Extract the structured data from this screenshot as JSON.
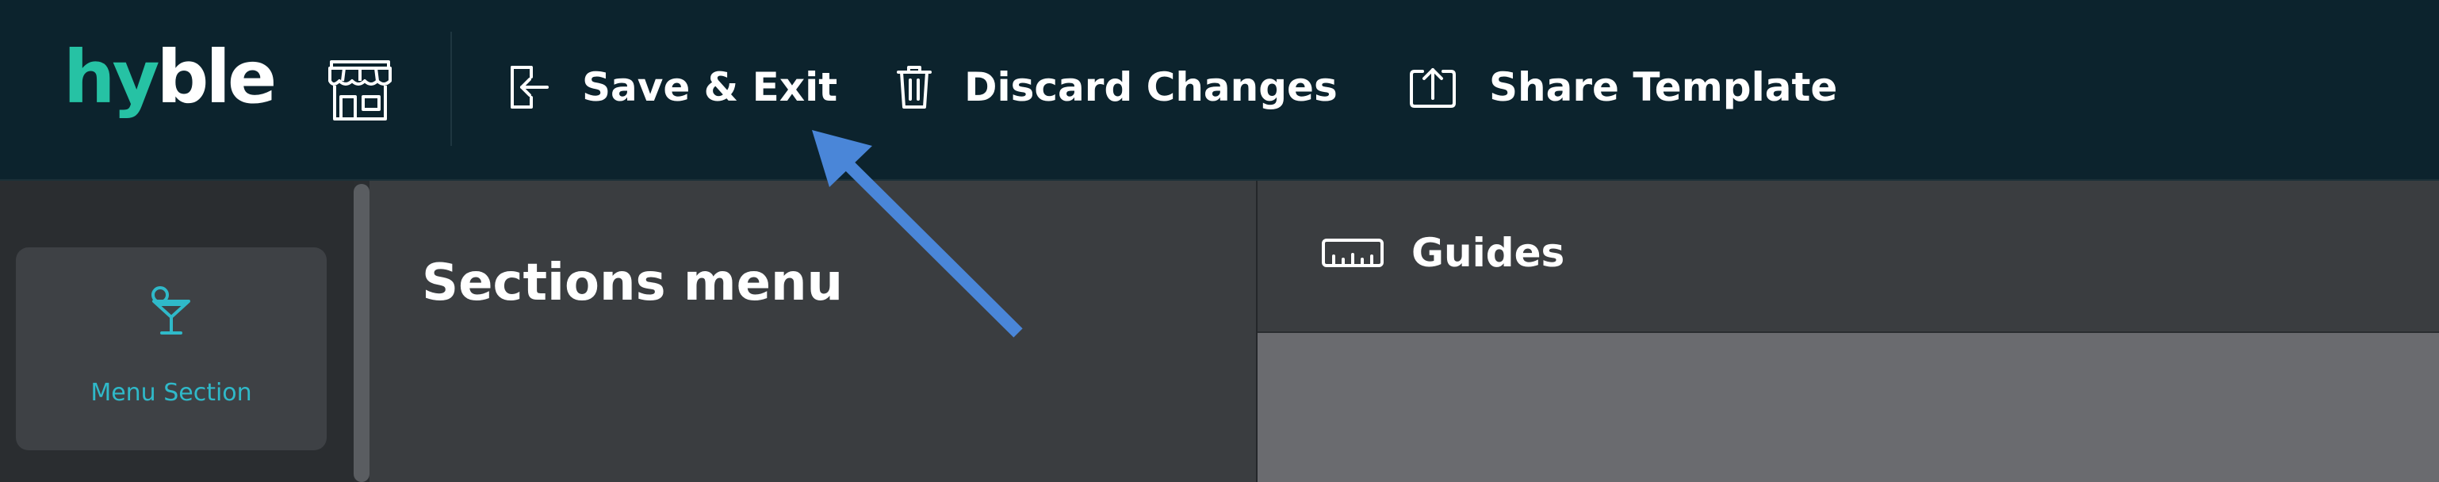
{
  "topbar": {
    "logo_hy": "hy",
    "logo_ble": "ble",
    "store_icon": "storefront-icon",
    "actions": {
      "save_exit": {
        "label": "Save & Exit",
        "icon": "exit-icon"
      },
      "discard": {
        "label": "Discard Changes",
        "icon": "trash-icon"
      },
      "share": {
        "label": "Share Template",
        "icon": "share-upload-icon"
      }
    }
  },
  "sidebar": {
    "items": [
      {
        "label": "Menu Section",
        "icon": "cocktail-glass-icon"
      }
    ]
  },
  "sections_panel": {
    "title": "Sections menu"
  },
  "canvas_toolbar": {
    "guides_label": "Guides",
    "guides_icon": "ruler-icon"
  },
  "colors": {
    "topbar_bg": "#0c232d",
    "brand_teal": "#26c2a4",
    "accent_cyan": "#2fb9c9",
    "annotation_arrow": "#4a86d8"
  }
}
